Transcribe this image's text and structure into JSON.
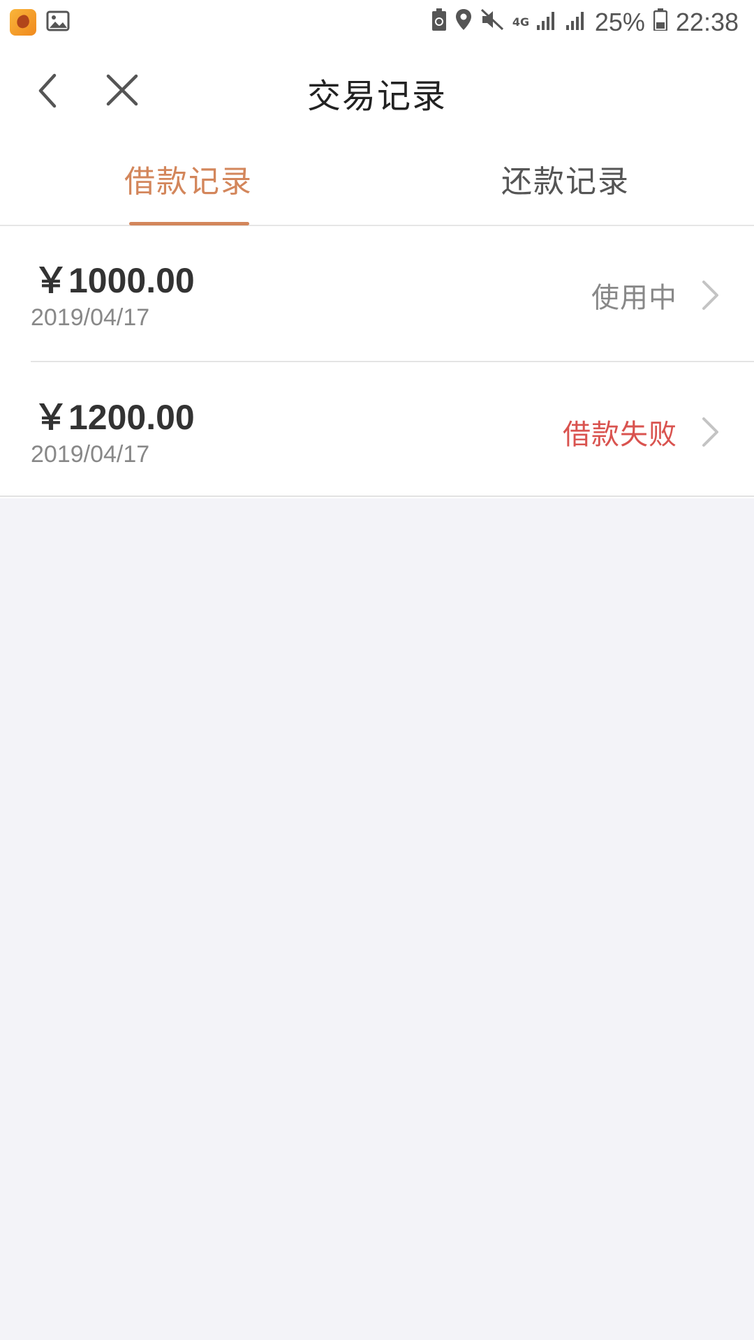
{
  "statusbar": {
    "battery_percent": "25%",
    "time": "22:38",
    "network_label": "4G",
    "icons": [
      "app-icon",
      "gallery-icon",
      "battery-saver-icon",
      "location-icon",
      "mute-icon",
      "signal-icon",
      "signal-icon",
      "battery-icon"
    ]
  },
  "header": {
    "title": "交易记录"
  },
  "tabs": [
    {
      "label": "借款记录",
      "active": true
    },
    {
      "label": "还款记录",
      "active": false
    }
  ],
  "records": [
    {
      "amount": "￥1000.00",
      "date": "2019/04/17",
      "status": "使用中",
      "status_color": "#888888"
    },
    {
      "amount": "￥1200.00",
      "date": "2019/04/17",
      "status": "借款失败",
      "status_color": "#d9534f"
    }
  ],
  "colors": {
    "accent": "#d3865b",
    "background": "#f3f3f8"
  }
}
